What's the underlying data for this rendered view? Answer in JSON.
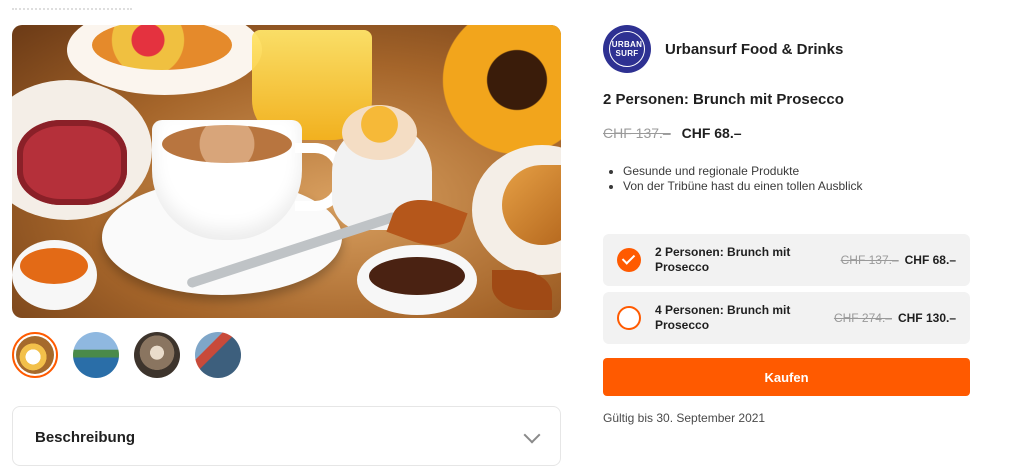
{
  "gallery": {
    "thumbnails": [
      "brunch",
      "pool",
      "interior",
      "venue"
    ]
  },
  "description": {
    "title": "Beschreibung"
  },
  "vendor": {
    "logo_text": "URBAN SURF",
    "name": "Urbansurf Food & Drinks"
  },
  "product": {
    "title": "2 Personen: Brunch mit Prosecco",
    "old_price": "CHF 137.–",
    "price": "CHF 68.–",
    "features": [
      "Gesunde und regionale Produkte",
      "Von der Tribüne hast du einen tollen Ausblick"
    ]
  },
  "options": [
    {
      "label": "2 Personen: Brunch mit Prosecco",
      "old_price": "CHF 137.–",
      "price": "CHF 68.–",
      "selected": true
    },
    {
      "label": "4 Personen: Brunch mit Prosecco",
      "old_price": "CHF 274.–",
      "price": "CHF 130.–",
      "selected": false
    }
  ],
  "buy_button": {
    "label": "Kaufen"
  },
  "validity": "Gültig bis 30. September 2021",
  "colors": {
    "accent": "#ff5a00",
    "logo_bg": "#2e3192"
  }
}
